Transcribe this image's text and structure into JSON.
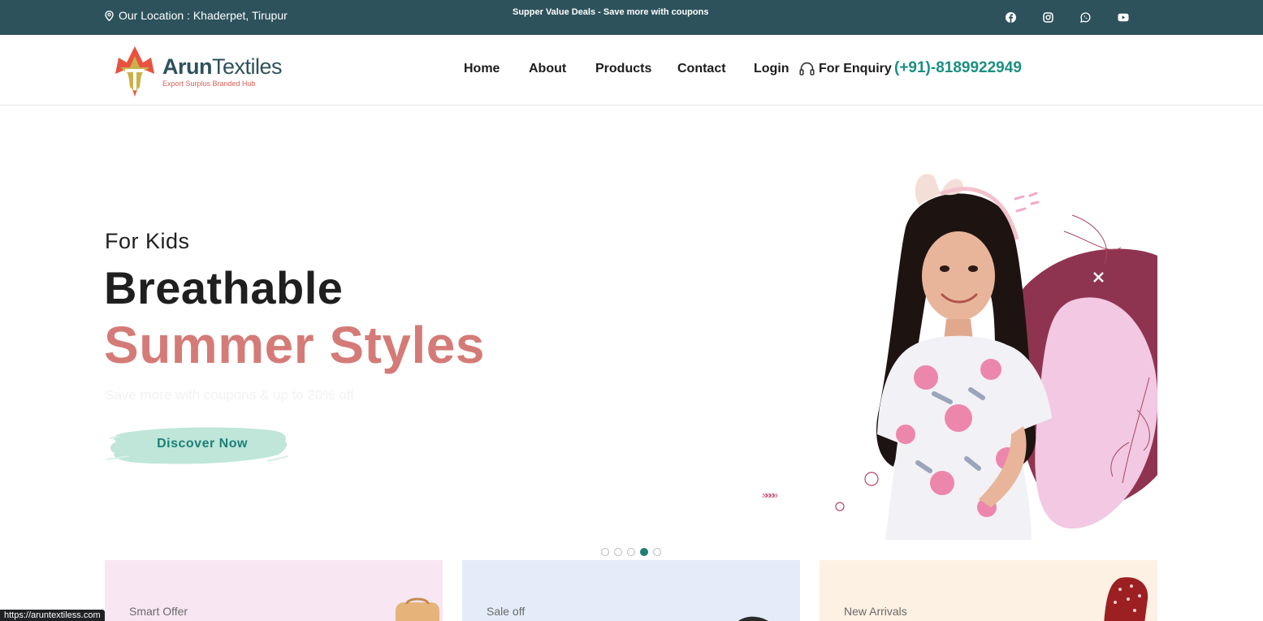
{
  "topbar": {
    "location": "Our Location : Khaderpet, Tirupur",
    "deal_text": "Supper Value Deals - Save more with coupons",
    "social_icons": [
      "facebook-icon",
      "instagram-icon",
      "whatsapp-icon",
      "youtube-icon"
    ]
  },
  "header": {
    "brand_part1": "Arun",
    "brand_part2": "Textiles",
    "tagline": "Export Surplus Branded Hub",
    "nav": [
      "Home",
      "About",
      "Products",
      "Contact",
      "Login"
    ],
    "enquiry_label": "For Enquiry",
    "phone": "(+91)-8189922949"
  },
  "hero": {
    "subtitle": "For Kids",
    "title_line1": "Breathable",
    "title_line2": "Summer Styles",
    "description": "Save more with coupons & up to 20% off",
    "cta": "Discover Now",
    "arrows": "»»»»",
    "slide_count": 5,
    "active_slide": 4
  },
  "cards": [
    {
      "label": "Smart Offer"
    },
    {
      "label": "Sale off"
    },
    {
      "label": "New Arrivals"
    }
  ],
  "status_bar": {
    "url": "https://aruntextiless.com"
  },
  "colors": {
    "topbar_bg": "#2d525c",
    "accent_teal": "#1b8f81",
    "accent_pink": "#d47b78",
    "cta_brush": "#bfe6d9",
    "card1_bg": "#f8e6f2",
    "card2_bg": "#e3ecf8",
    "card3_bg": "#fdf1e3"
  }
}
